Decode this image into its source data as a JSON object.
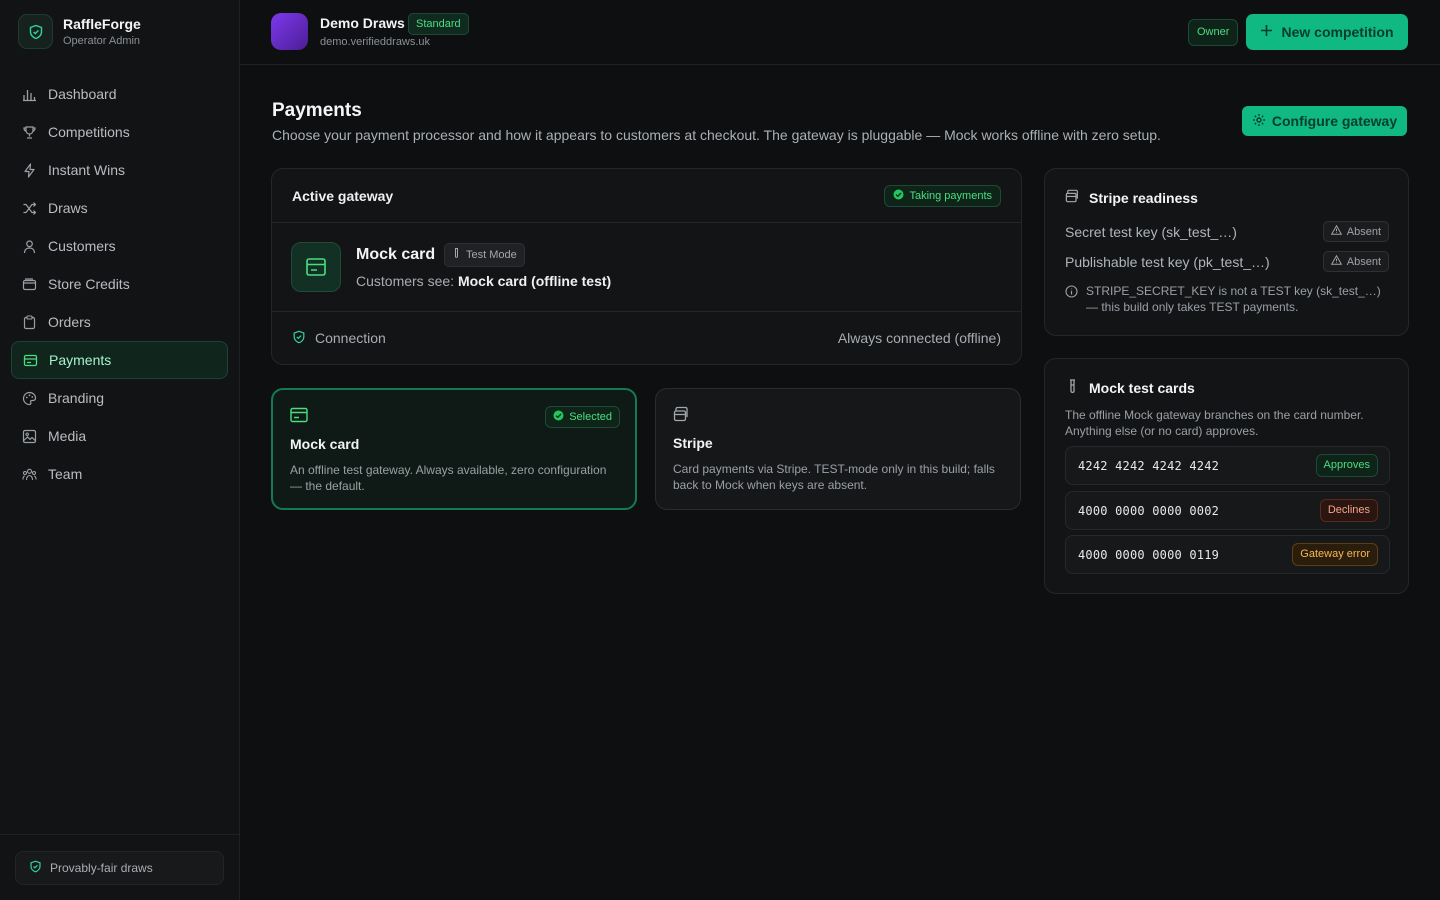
{
  "brand": {
    "name": "RaffleForge",
    "subtitle": "Operator Admin"
  },
  "sidebar": {
    "items": [
      {
        "label": "Dashboard",
        "icon": "bar-chart-icon",
        "active": false
      },
      {
        "label": "Competitions",
        "icon": "trophy-icon",
        "active": false
      },
      {
        "label": "Instant Wins",
        "icon": "lightning-icon",
        "active": false
      },
      {
        "label": "Draws",
        "icon": "shuffle-icon",
        "active": false
      },
      {
        "label": "Customers",
        "icon": "user-icon",
        "active": false
      },
      {
        "label": "Store Credits",
        "icon": "wallet-icon",
        "active": false
      },
      {
        "label": "Orders",
        "icon": "clipboard-icon",
        "active": false
      },
      {
        "label": "Payments",
        "icon": "credit-card-icon",
        "active": true
      },
      {
        "label": "Branding",
        "icon": "palette-icon",
        "active": false
      },
      {
        "label": "Media",
        "icon": "image-icon",
        "active": false
      },
      {
        "label": "Team",
        "icon": "team-icon",
        "active": false
      }
    ],
    "footer_badge": "Provably-fair draws"
  },
  "topbar": {
    "org_name": "Demo Draws",
    "plan": "Standard",
    "domain": "demo.verifieddraws.uk",
    "role": "Owner",
    "new_button": "New competition"
  },
  "page": {
    "title": "Payments",
    "description": "Choose your payment processor and how it appears to customers at checkout. The gateway is pluggable — Mock works offline with zero setup.",
    "configure_button": "Configure gateway"
  },
  "active_gateway": {
    "heading": "Active gateway",
    "status": "Taking payments",
    "name": "Mock card",
    "mode": "Test Mode",
    "customers_see_label": "Customers see:",
    "customers_see_value": "Mock card (offline test)",
    "connection_label": "Connection",
    "connection_value": "Always connected (offline)"
  },
  "options": [
    {
      "title": "Mock card",
      "selected_label": "Selected",
      "description": "An offline test gateway. Always available, zero configuration — the default."
    },
    {
      "title": "Stripe",
      "description": "Card payments via Stripe. TEST-mode only in this build; falls back to Mock when keys are absent."
    }
  ],
  "stripe_readiness": {
    "heading": "Stripe readiness",
    "keys": [
      {
        "label": "Secret test key (sk_test_…)",
        "status": "Absent"
      },
      {
        "label": "Publishable test key (pk_test_…)",
        "status": "Absent"
      }
    ],
    "warning": "STRIPE_SECRET_KEY is not a TEST key (sk_test_…) — this build only takes TEST payments."
  },
  "mock_test_cards": {
    "heading": "Mock test cards",
    "description": "The offline Mock gateway branches on the card number. Anything else (or no card) approves.",
    "cards": [
      {
        "number": "4242 4242 4242 4242",
        "result": "Approves"
      },
      {
        "number": "4000 0000 0000 0002",
        "result": "Declines"
      },
      {
        "number": "4000 0000 0000 0119",
        "result": "Gateway error"
      }
    ]
  },
  "colors": {
    "accent": "#10b981",
    "success_text": "#4ade80",
    "decline": "#f5a58a",
    "error": "#f6b656",
    "background": "#0e0f10"
  }
}
